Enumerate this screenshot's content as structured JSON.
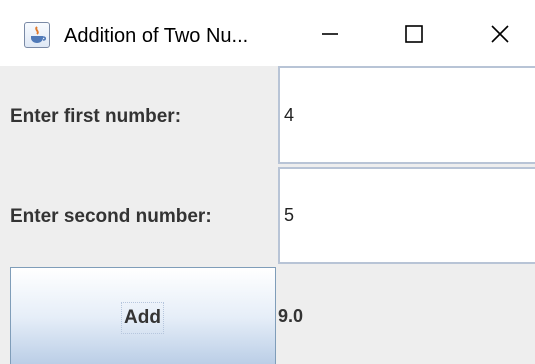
{
  "window": {
    "title": "Addition of Two Nu...",
    "controls": {
      "minimize": "minimize",
      "maximize": "maximize",
      "close": "close"
    }
  },
  "form": {
    "first_label": "Enter first number:",
    "first_value": "4",
    "second_label": "Enter second number:",
    "second_value": "5",
    "add_label": "Add",
    "result": "9.0"
  },
  "icons": {
    "app": "java-cup-icon",
    "minimize": "minimize-icon",
    "maximize": "maximize-icon",
    "close": "close-icon"
  },
  "colors": {
    "titlebar_bg": "#ffffff",
    "window_bg": "#eeeeee",
    "field_border": "#b8c4d6",
    "button_gradient": [
      "#ffffff",
      "#b9cde6"
    ]
  }
}
